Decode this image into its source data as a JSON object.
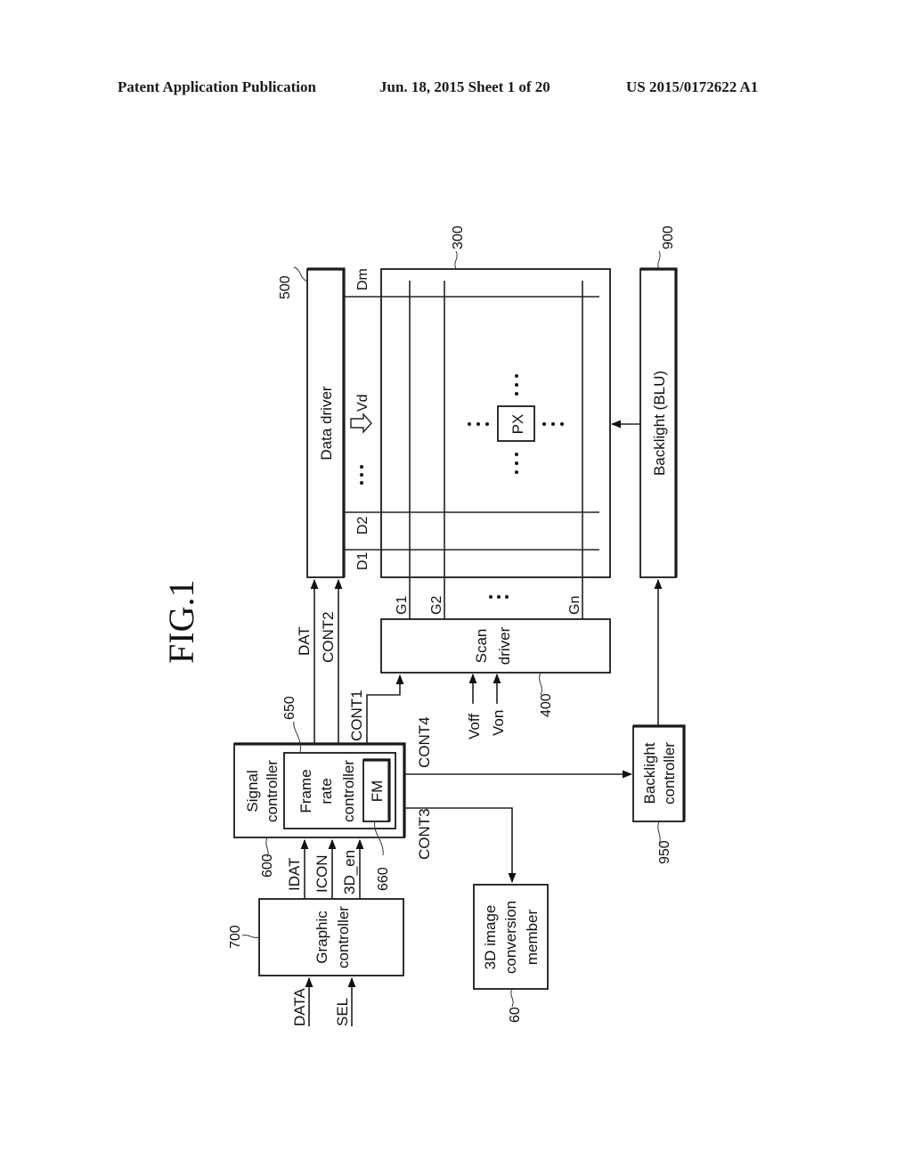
{
  "header": {
    "publication": "Patent Application Publication",
    "date_sheet": "Jun. 18, 2015  Sheet 1 of 20",
    "pub_number": "US 2015/0172622 A1"
  },
  "figure": {
    "title": "FIG.1",
    "blocks": {
      "data_driver": {
        "label": "Data driver",
        "ref": "500"
      },
      "panel": {
        "ref": "300",
        "pixel_label": "PX"
      },
      "backlight": {
        "label": "Backlight (BLU)",
        "ref": "900"
      },
      "scan_driver": {
        "label_line1": "Scan",
        "label_line2": "driver",
        "ref": "400"
      },
      "signal_controller": {
        "label_line1": "Signal",
        "label_line2": "controller",
        "ref": "600"
      },
      "frame_rate_controller": {
        "label_line1": "Frame",
        "label_line2": "rate",
        "label_line3": "controller",
        "ref": "650"
      },
      "frame_memory": {
        "label": "FM",
        "ref": "660"
      },
      "graphic_controller": {
        "label_line1": "Graphic",
        "label_line2": "controller",
        "ref": "700"
      },
      "image_conversion": {
        "label_line1": "3D image",
        "label_line2": "conversion",
        "label_line3": "member",
        "ref": "60"
      },
      "backlight_controller": {
        "label_line1": "Backlight",
        "label_line2": "controller",
        "ref": "950"
      }
    },
    "data_lines": [
      "D1",
      "D2",
      "Dm"
    ],
    "gate_lines": [
      "G1",
      "G2",
      "Gn"
    ],
    "data_voltage": "Vd",
    "ellipsis": "…",
    "signals": {
      "dat": "DAT",
      "cont1": "CONT1",
      "cont2": "CONT2",
      "cont3": "CONT3",
      "cont4": "CONT4",
      "idat": "IDAT",
      "icon": "ICON",
      "en3d": "3D_en",
      "data": "DATA",
      "sel": "SEL",
      "voff": "Voff",
      "von": "Von"
    }
  }
}
